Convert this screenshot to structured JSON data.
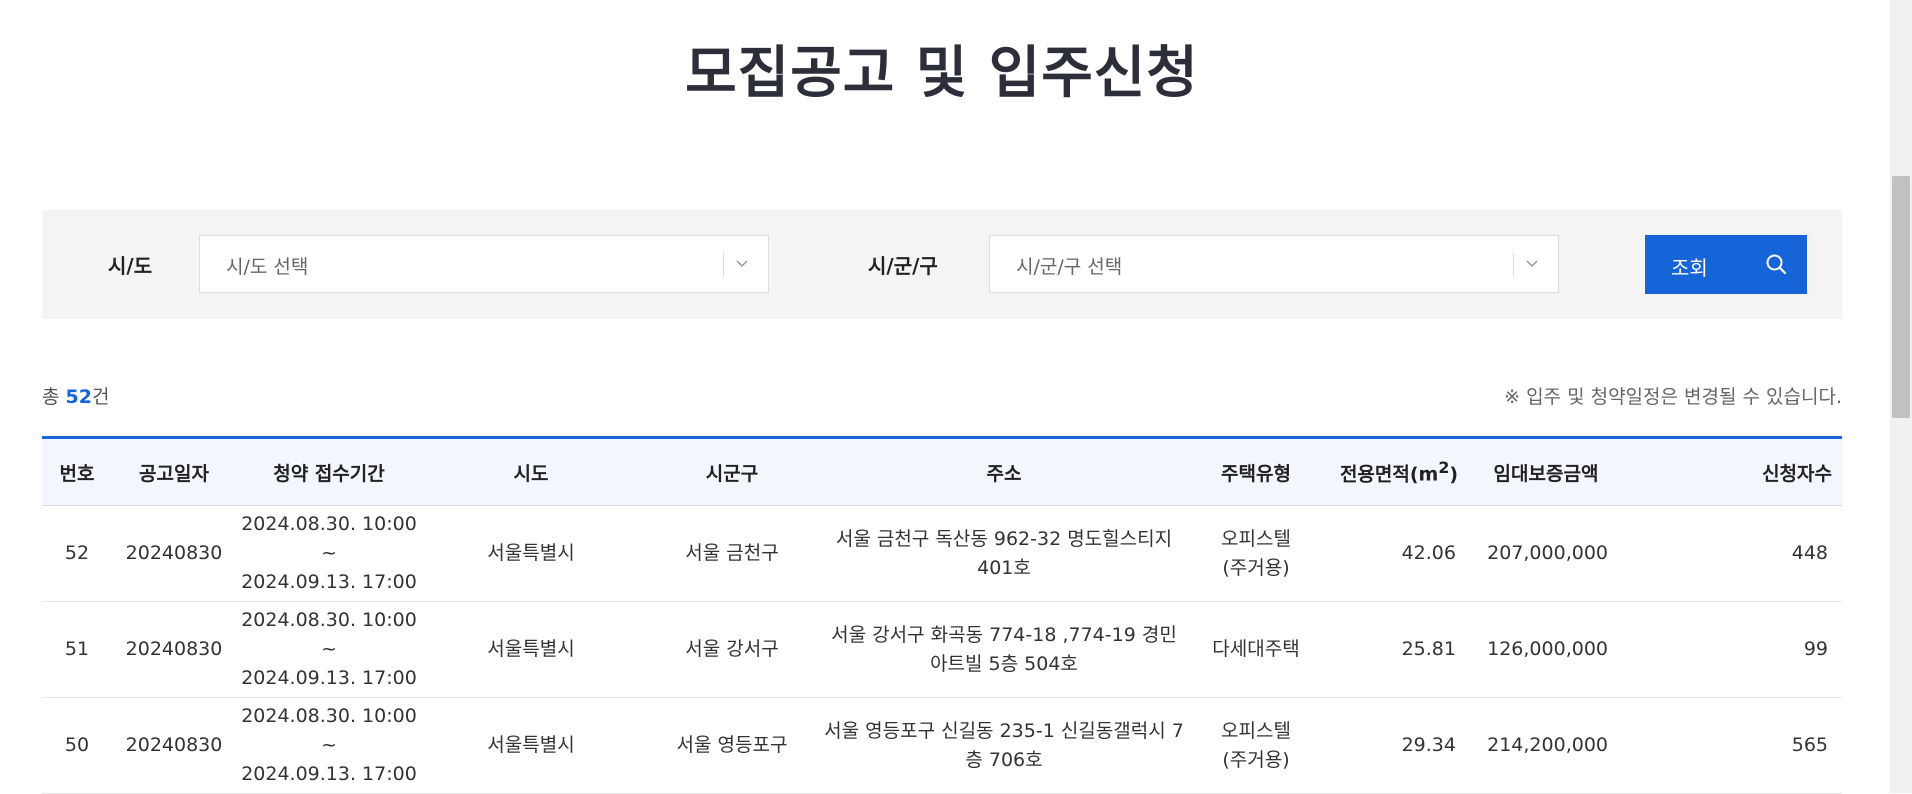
{
  "page": {
    "title": "모집공고 및 입주신청"
  },
  "filters": {
    "sido_label": "시/도",
    "sido_select": "시/도 선택",
    "sigungu_label": "시/군/구",
    "sigungu_select": "시/군/구 선택",
    "search_button": "조회"
  },
  "summary": {
    "prefix": "총 ",
    "count": "52",
    "suffix": "건",
    "notice": "※ 입주 및 청약일정은 변경될 수 있습니다."
  },
  "table": {
    "headers": [
      "번호",
      "공고일자",
      "청약 접수기간",
      "시도",
      "시군구",
      "주소",
      "주택유형",
      "전용면적(m",
      "임대보증금액",
      "신청자수"
    ],
    "area_sup": "2",
    "area_close": ")",
    "rows": [
      {
        "no": "52",
        "date": "20240830",
        "period1": "2024.08.30. 10:00 ~",
        "period2": "2024.09.13. 17:00",
        "sido": "서울특별시",
        "sigungu": "서울 금천구",
        "address": "서울 금천구 독산동 962-32 명도힐스티지 401호",
        "type1": "오피스텔",
        "type2": "(주거용)",
        "area": "42.06",
        "deposit": "207,000,000",
        "applicants": "448"
      },
      {
        "no": "51",
        "date": "20240830",
        "period1": "2024.08.30. 10:00 ~",
        "period2": "2024.09.13. 17:00",
        "sido": "서울특별시",
        "sigungu": "서울 강서구",
        "address": "서울 강서구 화곡동 774-18 ,774-19 경민아트빌 5층 504호",
        "type1": "다세대주택",
        "type2": "",
        "area": "25.81",
        "deposit": "126,000,000",
        "applicants": "99"
      },
      {
        "no": "50",
        "date": "20240830",
        "period1": "2024.08.30. 10:00 ~",
        "period2": "2024.09.13. 17:00",
        "sido": "서울특별시",
        "sigungu": "서울 영등포구",
        "address": "서울 영등포구 신길동 235-1 신길동갤럭시 7층 706호",
        "type1": "오피스텔",
        "type2": "(주거용)",
        "area": "29.34",
        "deposit": "214,200,000",
        "applicants": "565"
      }
    ]
  },
  "icons": {
    "chevron": "chevron-down-icon",
    "search": "search-icon"
  },
  "colors": {
    "accent": "#1565d8",
    "title": "#2c2f3a",
    "filter_bg": "#f4f4f4",
    "header_bg": "#f3f7fd"
  }
}
